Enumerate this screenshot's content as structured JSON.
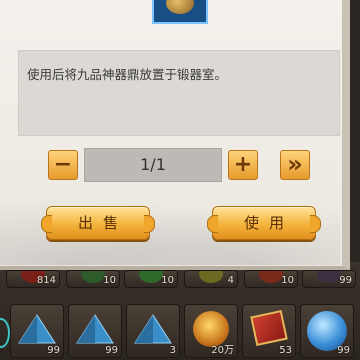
{
  "dialog": {
    "description": "使用后将九品神器鼎放置于锻器室。",
    "quantity": "1/1",
    "minus_label": "−",
    "plus_label": "+",
    "max_label": "»",
    "sell_label": "出售",
    "use_label": "使用"
  },
  "inventory": {
    "top_row": [
      {
        "count": "814",
        "icon": "red-orb-icon"
      },
      {
        "count": "10",
        "icon": "green-orb-icon"
      },
      {
        "count": "10",
        "icon": "green-orb-icon"
      },
      {
        "count": "4",
        "icon": "yellow-orb-icon"
      },
      {
        "count": "10",
        "icon": "red-orb-icon"
      },
      {
        "count": "99",
        "icon": "dark-orb-icon"
      }
    ],
    "bottom_row": [
      {
        "count": "99",
        "icon": "blue-crystal-icon"
      },
      {
        "count": "99",
        "icon": "blue-crystal-icon"
      },
      {
        "count": "3",
        "icon": "blue-crystal-icon"
      },
      {
        "count": "20万",
        "icon": "gold-coin-icon"
      },
      {
        "count": "53",
        "icon": "red-scroll-icon"
      },
      {
        "count": "99",
        "icon": "blue-sphere-icon"
      }
    ]
  }
}
